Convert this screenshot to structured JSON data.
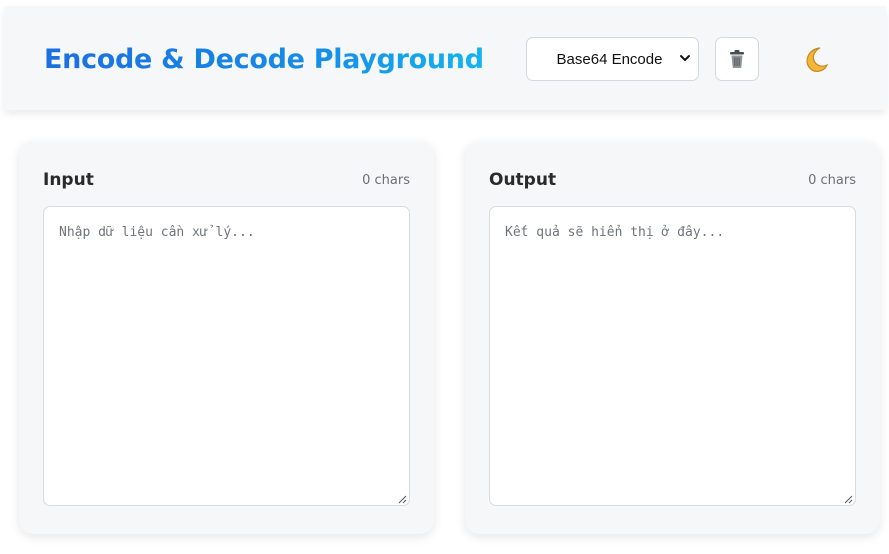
{
  "header": {
    "title": "Encode & Decode Playground",
    "mode_select": {
      "selected": "Base64 Encode"
    },
    "clear_icon": "trash-icon",
    "theme_icon": "moon-icon"
  },
  "input_panel": {
    "title": "Input",
    "count": "0 chars",
    "placeholder": "Nhập dữ liệu cần xử lý..."
  },
  "output_panel": {
    "title": "Output",
    "count": "0 chars",
    "placeholder": "Kết quả sẽ hiển thị ở đây..."
  },
  "colors": {
    "title_gradient_start": "#1b6fe0",
    "title_gradient_end": "#12b4f2",
    "panel_bg": "#f6f7f9",
    "moon": "#f2b63a"
  }
}
